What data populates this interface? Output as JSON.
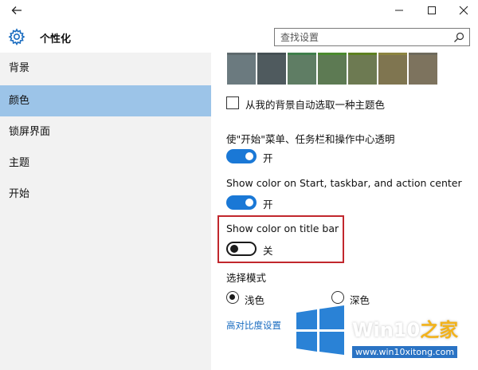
{
  "window": {
    "back_icon": "arrow-left-icon",
    "minimize_icon": "minimize-icon",
    "maximize_icon": "maximize-icon",
    "close_icon": "close-icon"
  },
  "header": {
    "title": "个性化",
    "icon": "gear-icon"
  },
  "search": {
    "placeholder": "查找设置",
    "icon": "search-icon"
  },
  "sidebar": {
    "items": [
      {
        "label": "背景",
        "active": false
      },
      {
        "label": "颜色",
        "active": true
      },
      {
        "label": "锁屏界面",
        "active": false
      },
      {
        "label": "主题",
        "active": false
      },
      {
        "label": "开始",
        "active": false
      }
    ]
  },
  "colors": {
    "accent": "#1a78d6",
    "sidebar_active": "#9cc4e8",
    "highlight_border": "#c1272d",
    "swatches": [
      {
        "fill": "#6b7a7f",
        "bar": "#5e6a6d"
      },
      {
        "fill": "#4f5a5e",
        "bar": "#455054"
      },
      {
        "fill": "#5f7d64",
        "bar": "#3f7e4b"
      },
      {
        "fill": "#5d7a53",
        "bar": "#4a8a2d"
      },
      {
        "fill": "#6d7a52",
        "bar": "#5d8020"
      },
      {
        "fill": "#7f7550",
        "bar": "#8c8440"
      },
      {
        "fill": "#7d735e",
        "bar": "#6e6a5c"
      }
    ]
  },
  "settings": {
    "auto_pick_label": "从我的背景自动选取一种主题色",
    "auto_pick_checked": false,
    "transparent_label": "使\"开始\"菜单、任务栏和操作中心透明",
    "transparent_state": "开",
    "start_color_label": "Show color on Start, taskbar, and action center",
    "start_color_state": "开",
    "title_bar_label": "Show color on title bar",
    "title_bar_state": "关",
    "mode_label": "选择模式",
    "mode_light": "浅色",
    "mode_dark": "深色",
    "mode_selected": "light",
    "high_contrast_link": "高对比度设置"
  },
  "watermark": {
    "brand_main": "Win10",
    "brand_accent": "之家",
    "url": "www.win10xitong.com"
  }
}
